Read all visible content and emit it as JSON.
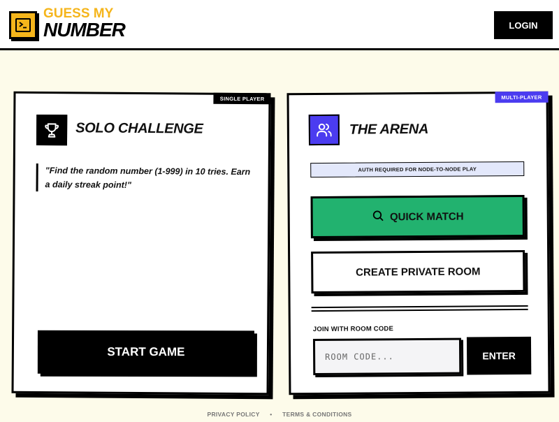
{
  "header": {
    "logo_line1": "GUESS MY",
    "logo_line2": "NUMBER",
    "login_label": "LOGIN"
  },
  "solo": {
    "tag": "SINGLE PLAYER",
    "title": "SOLO CHALLENGE",
    "description": "\"Find the random number (1-999) in 10 tries. Earn a daily streak point!\"",
    "start_label": "START GAME",
    "icon": "trophy-icon"
  },
  "arena": {
    "tag": "MULTI-PLAYER",
    "title": "THE ARENA",
    "auth_note": "AUTH REQUIRED FOR NODE-TO-NODE PLAY",
    "quick_match_label": "QUICK MATCH",
    "private_room_label": "CREATE PRIVATE ROOM",
    "join_label": "JOIN WITH ROOM CODE",
    "room_placeholder": "ROOM CODE...",
    "enter_label": "ENTER",
    "icon": "users-icon"
  },
  "footer": {
    "privacy": "PRIVACY POLICY",
    "separator": "•",
    "terms": "TERMS & CONDITIONS"
  },
  "colors": {
    "background": "#fdfbea",
    "brand_yellow": "#f5b51b",
    "purple": "#4b3cf0",
    "green": "#22b26f",
    "auth_banner": "#e3e8fb"
  }
}
